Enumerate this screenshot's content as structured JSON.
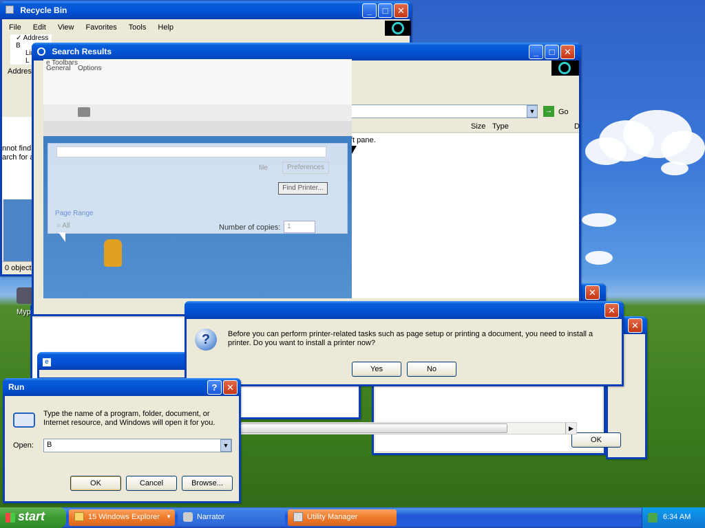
{
  "recycle_bin": {
    "title": "Recycle Bin",
    "menu": [
      "File",
      "Edit",
      "View",
      "Favorites",
      "Tools",
      "Help"
    ],
    "dropdown_items": [
      "Address B",
      "Lin",
      "L"
    ],
    "address_label": "Address",
    "status": "0 object"
  },
  "search_results": {
    "title": "Search Results",
    "tab_labels": [
      "General",
      "Options"
    ],
    "toolbar_label": "e Toolbars",
    "go_label": "Go",
    "col_size": "Size",
    "col_type": "Type",
    "col_d": "D",
    "pane_text": "ft pane.",
    "ghost": {
      "file": "file",
      "preferences": "Preferences",
      "find_printer": "Find Printer...",
      "page_range": "Page Range",
      "all": "All",
      "copies_label": "Number of copies:",
      "copies_value": "1"
    }
  },
  "left_partial": {
    "line1": "nnot find",
    "line2": "arch for a"
  },
  "desktop_icon_label": "Myp",
  "printer_dialog": {
    "message": "Before you can perform printer-related tasks such as page setup or printing a document, you need to install a printer. Do you want to install a printer now?",
    "yes": "Yes",
    "no": "No"
  },
  "back_ok": "OK",
  "run_dialog": {
    "title": "Run",
    "help": "?",
    "description": "Type the name of a program, folder, document, or Internet resource, and Windows will open it for you.",
    "open_label": "Open:",
    "open_value": "B",
    "ok": "OK",
    "cancel": "Cancel",
    "browse": "Browse..."
  },
  "taskbar": {
    "start": "start",
    "tasks": [
      {
        "label": "15 Windows Explorer"
      },
      {
        "label": "Narrator"
      },
      {
        "label": "Utility Manager"
      }
    ],
    "clock": "6:34 AM"
  },
  "colors": {
    "xp_blue": "#0453d6",
    "start_green": "#3c9a33",
    "task_orange": "#f0782a"
  }
}
